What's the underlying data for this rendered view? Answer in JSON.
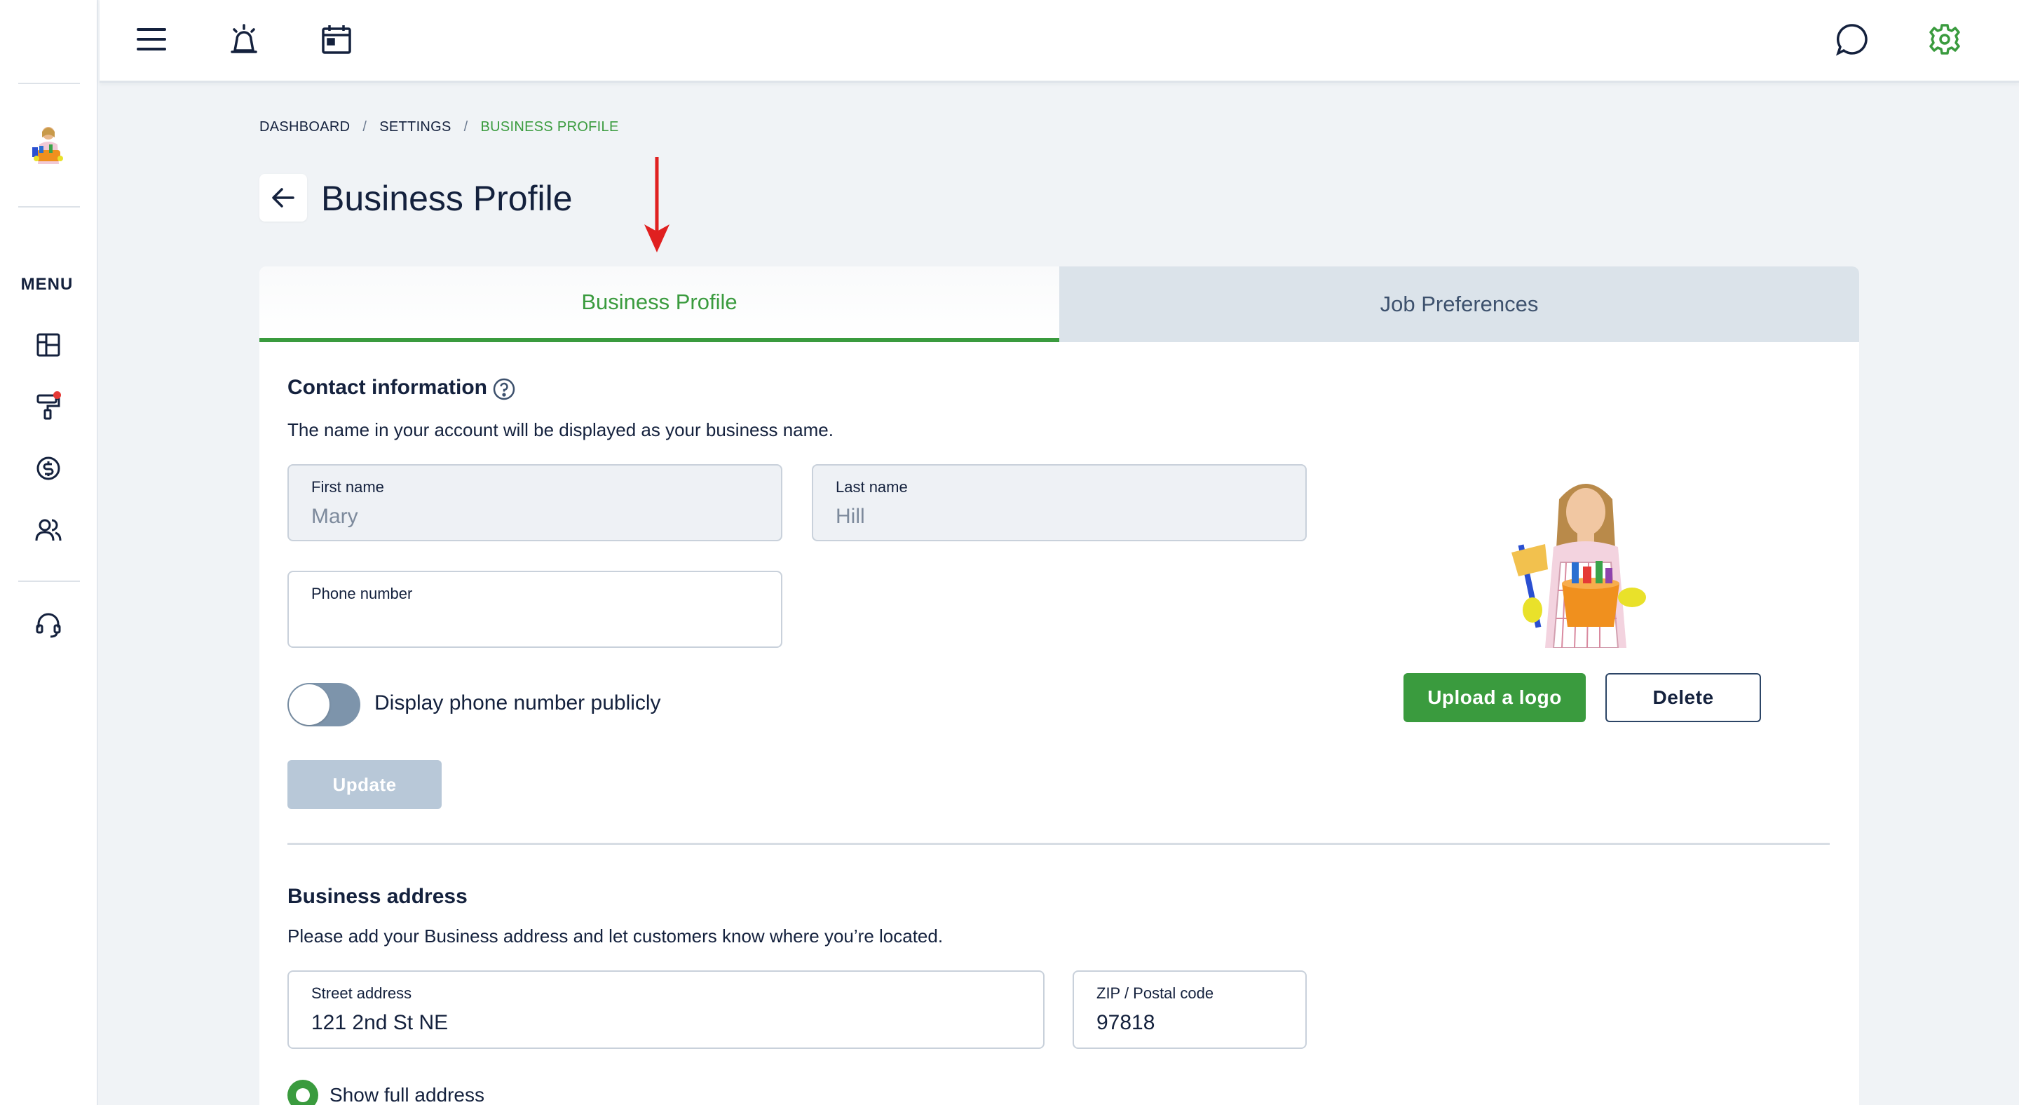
{
  "sidebar": {
    "menu_label": "MENU",
    "items": [
      {
        "icon": "dashboard-icon"
      },
      {
        "icon": "paint-roller-icon",
        "notification": true
      },
      {
        "icon": "dollar-icon"
      },
      {
        "icon": "users-icon"
      },
      {
        "icon": "headset-icon"
      }
    ]
  },
  "topbar": {
    "icons": [
      "hamburger-menu-icon",
      "alarm-icon",
      "calendar-icon",
      "chat-icon",
      "settings-gear-icon"
    ]
  },
  "breadcrumb": {
    "items": [
      "DASHBOARD",
      "SETTINGS",
      "BUSINESS PROFILE"
    ],
    "separator": "/"
  },
  "page": {
    "title": "Business Profile"
  },
  "tabs": {
    "active": "Business Profile",
    "inactive": "Job Preferences"
  },
  "contact": {
    "title": "Contact information",
    "description": "The name in your account will be displayed as your business name.",
    "first_name_label": "First name",
    "first_name_value": "Mary",
    "last_name_label": "Last name",
    "last_name_value": "Hill",
    "phone_label": "Phone number",
    "phone_value": "",
    "toggle_label": "Display phone number publicly",
    "toggle_on": false,
    "update_label": "Update",
    "upload_label": "Upload a logo",
    "delete_label": "Delete"
  },
  "address": {
    "title": "Business address",
    "description": "Please add your Business address and let customers know where you’re located.",
    "street_label": "Street address",
    "street_value": "121 2nd St NE",
    "zip_label": "ZIP / Postal code",
    "zip_value": "97818",
    "radio_label": "Show full address"
  },
  "colors": {
    "accent": "#3a9b3e",
    "navy": "#14213d",
    "tab_inactive_bg": "#dbe3ea",
    "annotation_arrow": "#e02020"
  }
}
